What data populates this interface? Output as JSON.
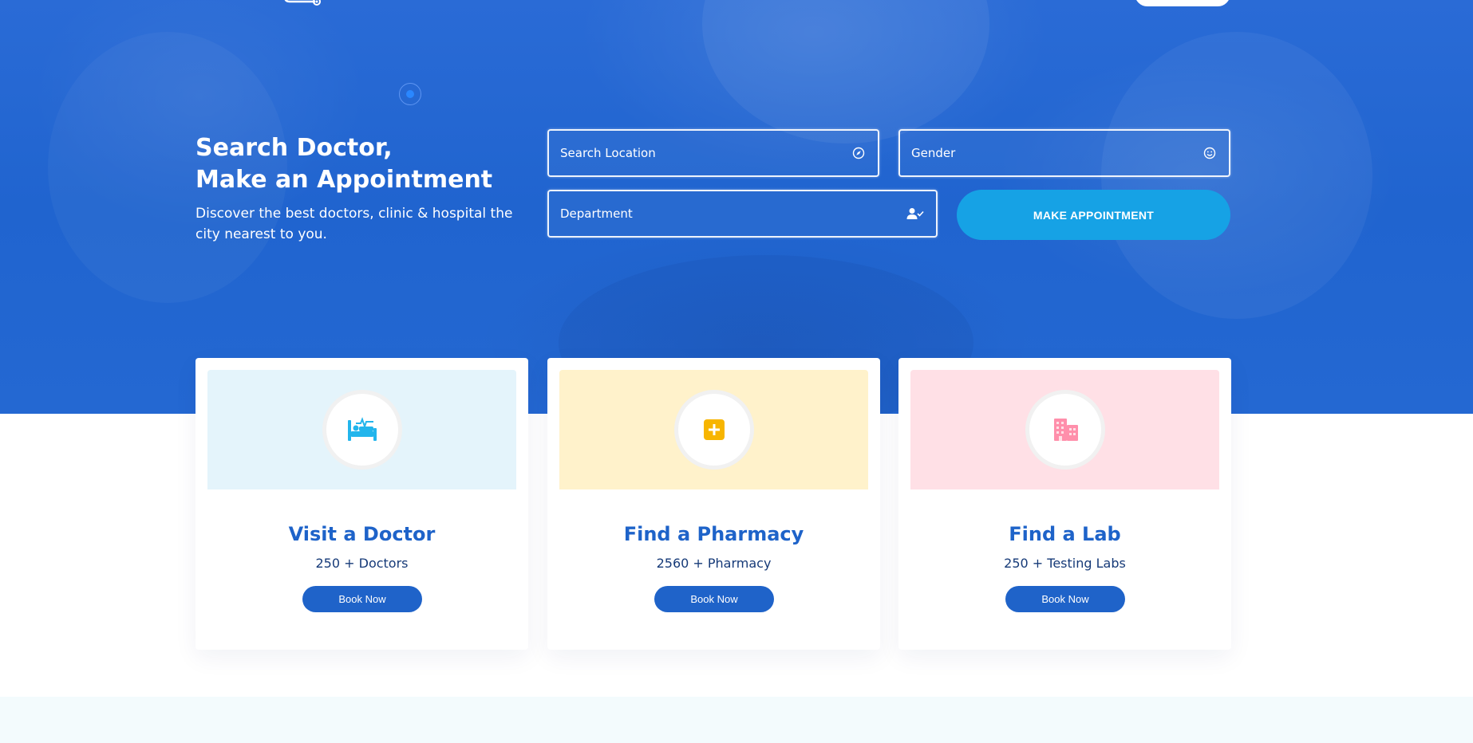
{
  "hero": {
    "title_line1": "Search Doctor,",
    "title_line2": "Make an Appointment",
    "subtitle": "Discover the best doctors, clinic & hospital the city nearest to you."
  },
  "search": {
    "location_placeholder": "Search Location",
    "gender_placeholder": "Gender",
    "department_placeholder": "Department",
    "submit_label": "MAKE APPOINTMENT"
  },
  "services": [
    {
      "title": "Visit a Doctor",
      "count": "250 + Doctors",
      "button": "Book Now",
      "icon": "hospital-bed-icon",
      "accent": "#22b5ec",
      "band": "#e4f4fb"
    },
    {
      "title": "Find a Pharmacy",
      "count": "2560 + Pharmacy",
      "button": "Book Now",
      "icon": "pharmacy-plus-icon",
      "accent": "#f7b500",
      "band": "#fff2cb"
    },
    {
      "title": "Find a Lab",
      "count": "250 + Testing Labs",
      "button": "Book Now",
      "icon": "lab-building-icon",
      "accent": "#ff8fab",
      "band": "#ffe0e6"
    }
  ],
  "colors": {
    "hero_bg": "#2064cf",
    "primary": "#1f63c9",
    "cta": "#16a2e5"
  }
}
